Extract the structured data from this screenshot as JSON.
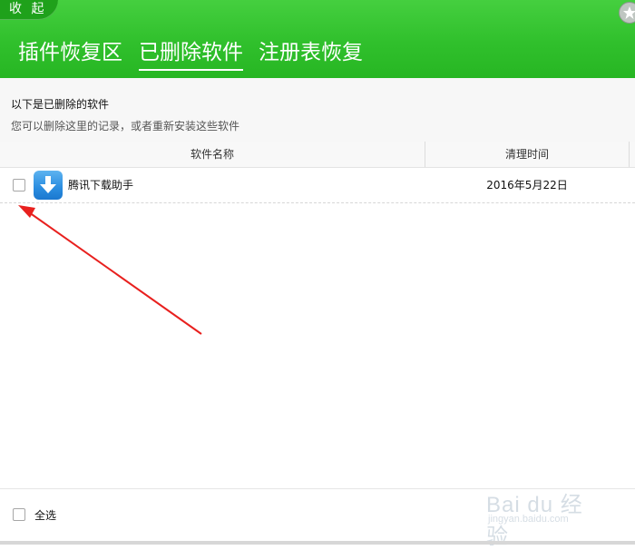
{
  "header": {
    "collapse_label": "收 起",
    "tabs": [
      {
        "label": "插件恢复区",
        "active": false
      },
      {
        "label": "已删除软件",
        "active": true
      },
      {
        "label": "注册表恢复",
        "active": false
      }
    ],
    "brand_color": "#2ebf2a",
    "pin_icon": "star-pin-icon"
  },
  "info": {
    "title": "以下是已删除的软件",
    "description": "您可以删除这里的记录，或者重新安装这些软件"
  },
  "table": {
    "columns": [
      "软件名称",
      "清理时间"
    ],
    "rows": [
      {
        "checked": false,
        "icon": "download-arrow-icon",
        "name": "腾讯下载助手",
        "time": "2016年5月22日"
      }
    ]
  },
  "footer": {
    "select_all_label": "全选",
    "select_all_checked": false
  },
  "annotation": {
    "arrow_color": "#e8201e"
  },
  "watermark": {
    "main": "Bai du 经验",
    "sub": "jingyan.baidu.com"
  }
}
